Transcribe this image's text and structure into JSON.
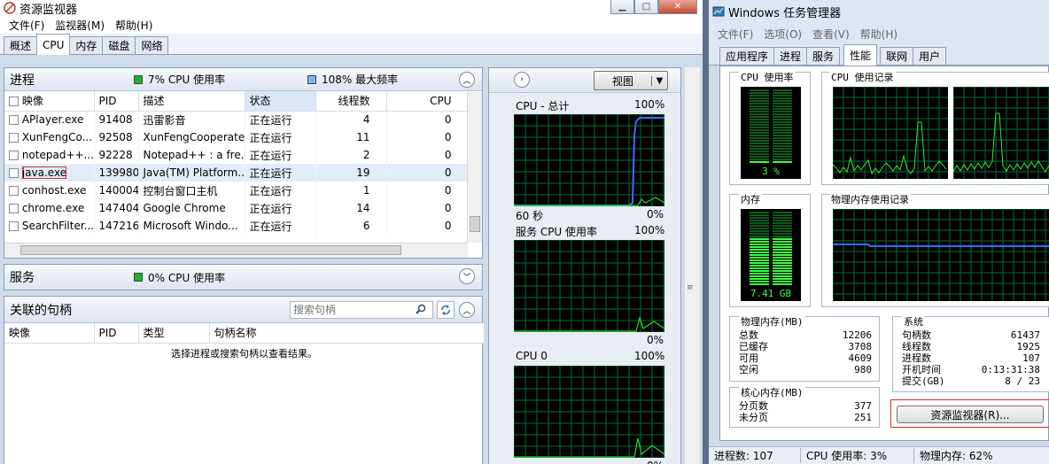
{
  "rm": {
    "title": "资源监视器",
    "menu": [
      "文件(F)",
      "监视器(M)",
      "帮助(H)"
    ],
    "tabs": [
      "概述",
      "CPU",
      "内存",
      "磁盘",
      "网络"
    ],
    "process": {
      "title": "进程",
      "cpu_usage": "7% CPU 使用率",
      "max_freq": "108% 最大频率",
      "headers": [
        "映像",
        "PID",
        "描述",
        "状态",
        "线程数",
        "CPU"
      ],
      "rows": [
        {
          "image": "APlayer.exe",
          "pid": "91408",
          "desc": "迅雷影音",
          "status": "正在运行",
          "threads": "4",
          "cpu": "0"
        },
        {
          "image": "XunFengCo...",
          "pid": "92508",
          "desc": "XunFengCooperate",
          "status": "正在运行",
          "threads": "11",
          "cpu": "0"
        },
        {
          "image": "notepad++....",
          "pid": "92228",
          "desc": "Notepad++ : a fre...",
          "status": "正在运行",
          "threads": "2",
          "cpu": "0"
        },
        {
          "image": "java.exe",
          "pid": "139980",
          "desc": "Java(TM) Platform...",
          "status": "正在运行",
          "threads": "19",
          "cpu": "0"
        },
        {
          "image": "conhost.exe",
          "pid": "140004",
          "desc": "控制台窗口主机",
          "status": "正在运行",
          "threads": "1",
          "cpu": "0"
        },
        {
          "image": "chrome.exe",
          "pid": "147404",
          "desc": "Google Chrome",
          "status": "正在运行",
          "threads": "14",
          "cpu": "0"
        },
        {
          "image": "SearchFilter...",
          "pid": "147216",
          "desc": "Microsoft Windo...",
          "status": "正在运行",
          "threads": "6",
          "cpu": "0"
        }
      ]
    },
    "services": {
      "title": "服务",
      "cpu_usage": "0% CPU 使用率"
    },
    "handles": {
      "title": "关联的句柄",
      "search_placeholder": "搜索句柄",
      "headers": [
        "映像",
        "PID",
        "类型",
        "句柄名称"
      ],
      "empty": "选择进程或搜索句柄以查看结果。"
    },
    "graphs": {
      "view_label": "视图",
      "g1": {
        "title": "CPU - 总计",
        "max": "100%",
        "bottom_left": "60 秒",
        "min": "0%"
      },
      "g2": {
        "title": "服务 CPU 使用率",
        "max": "100%",
        "min": "0%"
      },
      "g3": {
        "title": "CPU 0",
        "max": "100%",
        "min": "0%"
      }
    }
  },
  "tm": {
    "title": "Windows 任务管理器",
    "menu": [
      "文件(F)",
      "选项(O)",
      "查看(V)",
      "帮助(H)"
    ],
    "tabs": [
      "应用程序",
      "进程",
      "服务",
      "性能",
      "联网",
      "用户"
    ],
    "cpu_usage_label": "CPU 使用率",
    "cpu_usage_value": "3 %",
    "cpu_history_label": "CPU 使用记录",
    "mem_label": "内存",
    "mem_value": "7.41 GB",
    "mem_history_label": "物理内存使用记录",
    "phys": {
      "title": "物理内存(MB)",
      "rows": [
        {
          "k": "总数",
          "v": "12206"
        },
        {
          "k": "已缓存",
          "v": "3708"
        },
        {
          "k": "可用",
          "v": "4609"
        },
        {
          "k": "空闲",
          "v": "980"
        }
      ]
    },
    "kernel": {
      "title": "核心内存(MB)",
      "rows": [
        {
          "k": "分页数",
          "v": "377"
        },
        {
          "k": "未分页",
          "v": "251"
        }
      ]
    },
    "system": {
      "title": "系统",
      "rows": [
        {
          "k": "句柄数",
          "v": "61437"
        },
        {
          "k": "线程数",
          "v": "1925"
        },
        {
          "k": "进程数",
          "v": "107"
        },
        {
          "k": "开机时间",
          "v": "0:13:31:38"
        },
        {
          "k": "提交(GB)",
          "v": "8 / 23"
        }
      ]
    },
    "resmon_button": "资源监视器(R)...",
    "status": {
      "procs": "进程数: 107",
      "cpu": "CPU 使用率: 3%",
      "mem": "物理内存: 62%"
    }
  }
}
